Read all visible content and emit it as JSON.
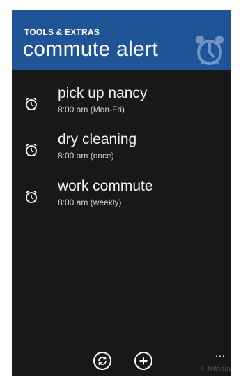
{
  "header": {
    "supertitle": "TOOLS & EXTRAS",
    "title": "commute alert",
    "logo_icon": "alarm-clock-icon",
    "background": "#1f5496"
  },
  "alerts": [
    {
      "name": "pick up nancy",
      "schedule": "8:00 am (Mon-Fri)",
      "icon": "alarm-clock-icon"
    },
    {
      "name": "dry cleaning",
      "schedule": "8:00 am (once)",
      "icon": "alarm-clock-icon"
    },
    {
      "name": "work commute",
      "schedule": "8:00 am (weekly)",
      "icon": "alarm-clock-icon"
    }
  ],
  "appbar": {
    "buttons": [
      {
        "icon": "sync-icon"
      },
      {
        "icon": "add-icon"
      }
    ],
    "more_label": "..."
  },
  "branding": {
    "text": "telenav",
    "icon": "telenav-logo-icon"
  }
}
